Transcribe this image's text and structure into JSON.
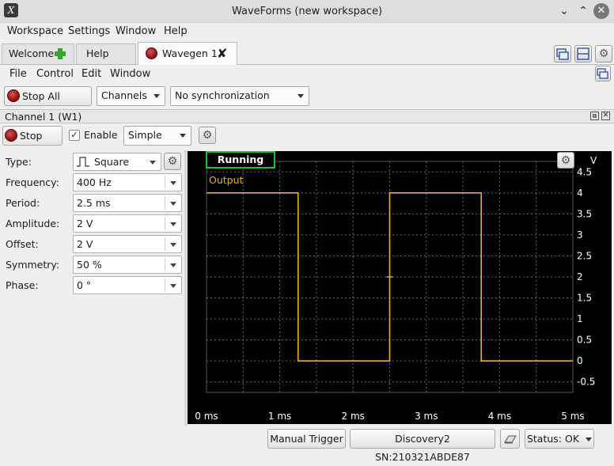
{
  "window": {
    "title": "WaveForms (new workspace)",
    "minimize_icon": "chevron-down-icon",
    "maximize_icon": "chevron-up-icon",
    "close_icon": "close-icon"
  },
  "menubar": {
    "items": [
      {
        "label": "Workspace"
      },
      {
        "label": "Settings"
      },
      {
        "label": "Window"
      },
      {
        "label": "Help"
      }
    ]
  },
  "tabs": [
    {
      "label": "Welcome",
      "icon": "plus-icon"
    },
    {
      "label": "Help"
    },
    {
      "label": "Wavegen 1",
      "icon": "stop-icon",
      "active": true,
      "close_icon": "close-icon"
    }
  ],
  "instrument_menu": {
    "items": [
      {
        "label": "File"
      },
      {
        "label": "Control"
      },
      {
        "label": "Edit"
      },
      {
        "label": "Window"
      }
    ]
  },
  "toolbar": {
    "stop_all_label": "Stop All",
    "channels_label": "Channels",
    "sync_label": "No synchronization"
  },
  "channel": {
    "header": "Channel 1 (W1)",
    "stop_label": "Stop",
    "enable_label": "Enable",
    "enable_checked": true,
    "mode_label": "Simple"
  },
  "params": [
    {
      "label": "Type:",
      "value": "Square",
      "icon": "square-wave-icon"
    },
    {
      "label": "Frequency:",
      "value": "400 Hz"
    },
    {
      "label": "Period:",
      "value": "2.5 ms"
    },
    {
      "label": "Amplitude:",
      "value": "2 V"
    },
    {
      "label": "Offset:",
      "value": "2 V"
    },
    {
      "label": "Symmetry:",
      "value": "50 %"
    },
    {
      "label": "Phase:",
      "value": "0 °"
    }
  ],
  "plot": {
    "status": "Running",
    "status_color": "#22c02a",
    "trace_label": "Output",
    "trace_color": "#e8b21e",
    "y_unit": "V"
  },
  "chart_data": {
    "type": "line",
    "series": [
      {
        "name": "Output",
        "x": [
          0,
          1.25,
          1.25,
          2.5,
          2.5,
          3.75,
          3.75,
          5
        ],
        "y": [
          4,
          4,
          0,
          0,
          4,
          4,
          0,
          0
        ]
      }
    ],
    "xlim": [
      0,
      5
    ],
    "ylim": [
      -0.75,
      4.75
    ],
    "x_ticks": [
      "0 ms",
      "1 ms",
      "2 ms",
      "3 ms",
      "4 ms",
      "5 ms"
    ],
    "y_ticks": [
      "4.5",
      "4",
      "3.5",
      "3",
      "2.5",
      "2",
      "1.5",
      "1",
      "0.5",
      "0",
      "-0.5"
    ],
    "y_tick_values": [
      4.5,
      4,
      3.5,
      3,
      2.5,
      2,
      1.5,
      1,
      0.5,
      0,
      -0.5
    ],
    "grid": true
  },
  "statusbar": {
    "manual_trigger": "Manual Trigger",
    "device": "Discovery2 SN:210321ABDE87",
    "status": "Status: OK"
  }
}
